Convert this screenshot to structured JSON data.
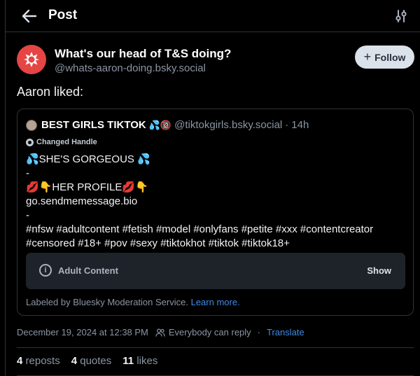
{
  "header": {
    "title": "Post",
    "back_icon": "arrow-left-icon",
    "filter_icon": "sliders-icon"
  },
  "author": {
    "display_name": "What's our head of T&S doing?",
    "handle": "@whats-aaron-doing.bsky.social",
    "avatar_icon": "starburst-icon",
    "avatar_color": "#e64545",
    "follow_label": "Follow"
  },
  "post": {
    "text": "Aaron liked:"
  },
  "quote": {
    "author_name": "BEST GIRLS TIKTOK",
    "author_emoji": "💦🔞",
    "author_handle": "@tiktokgirls.bsky.social",
    "separator": "·",
    "time": "14h",
    "changed_handle": "Changed Handle",
    "lines": [
      "💦SHE'S GORGEOUS 💦",
      "-",
      "💋👇HER PROFILE💋👇",
      "go.sendmemessage.bio",
      "-",
      "#nfsw #adultcontent #fetish #model #onlyfans #petite #xxx #contentcreator",
      "#censored #18+ #pov #sexy #tiktokhot #tiktok #tiktok18+"
    ],
    "warning_label": "Adult Content",
    "warning_action": "Show",
    "labeled_by": "Labeled by Bluesky Moderation Service.",
    "learn_more": "Learn more."
  },
  "meta": {
    "timestamp": "December 19, 2024 at 12:38 PM",
    "reply_setting": "Everybody can reply",
    "separator": "·",
    "translate": "Translate"
  },
  "stats": {
    "reposts_count": "4",
    "reposts_label": "reposts",
    "quotes_count": "4",
    "quotes_label": "quotes",
    "likes_count": "11",
    "likes_label": "likes"
  },
  "colors": {
    "background": "#000000",
    "accent_link": "#3f8ae6",
    "muted_text": "#8a95a3",
    "border": "#2e3339"
  }
}
